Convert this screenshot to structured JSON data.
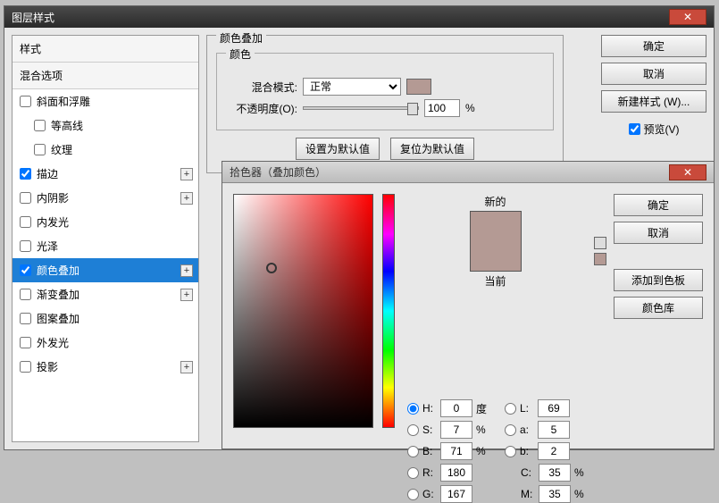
{
  "main": {
    "title": "图层样式",
    "sidebar": {
      "header": "样式",
      "blend_header": "混合选项",
      "items": [
        {
          "label": "斜面和浮雕",
          "checked": false,
          "plus": false
        },
        {
          "label": "等高线",
          "checked": false,
          "plus": false,
          "indent": true
        },
        {
          "label": "纹理",
          "checked": false,
          "plus": false,
          "indent": true
        },
        {
          "label": "描边",
          "checked": true,
          "plus": true
        },
        {
          "label": "内阴影",
          "checked": false,
          "plus": true
        },
        {
          "label": "内发光",
          "checked": false,
          "plus": false
        },
        {
          "label": "光泽",
          "checked": false,
          "plus": false
        },
        {
          "label": "颜色叠加",
          "checked": true,
          "plus": true,
          "selected": true
        },
        {
          "label": "渐变叠加",
          "checked": false,
          "plus": true
        },
        {
          "label": "图案叠加",
          "checked": false,
          "plus": false
        },
        {
          "label": "外发光",
          "checked": false,
          "plus": false
        },
        {
          "label": "投影",
          "checked": false,
          "plus": true
        }
      ]
    },
    "panel": {
      "title": "颜色叠加",
      "subtitle": "颜色",
      "blend_label": "混合模式:",
      "blend_value": "正常",
      "opacity_label": "不透明度(O):",
      "opacity_value": "100",
      "percent": "%",
      "set_default": "设置为默认值",
      "reset_default": "复位为默认值"
    },
    "buttons": {
      "ok": "确定",
      "cancel": "取消",
      "new_style": "新建样式 (W)...",
      "preview": "预览(V)"
    }
  },
  "picker": {
    "title": "拾色器（叠加颜色）",
    "new_label": "新的",
    "current_label": "当前",
    "ok": "确定",
    "cancel": "取消",
    "add_swatch": "添加到色板",
    "color_lib": "颜色库",
    "hsb": {
      "H": "0",
      "S": "7",
      "B": "71"
    },
    "lab": {
      "L": "69",
      "a": "5",
      "b": "2"
    },
    "rgb": {
      "R": "180",
      "G": "167"
    },
    "cmyk": {
      "C": "35",
      "M": "35"
    },
    "deg": "度",
    "pct": "%"
  }
}
